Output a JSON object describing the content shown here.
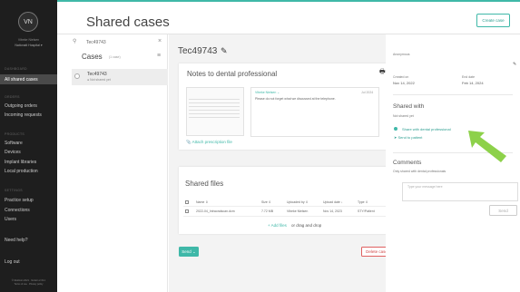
{
  "sidebar": {
    "avatar_initials": "VN",
    "user_name": "Vibeke Nielsen",
    "user_org": "Nationalt Hospital",
    "sections": [
      "DASHBOARD",
      "ORDERS",
      "PRODUCTS",
      "SETTINGS"
    ],
    "items": {
      "all_shared": "All shared cases",
      "outgoing": "Outgoing orders",
      "incoming": "Incoming requests",
      "software": "Software",
      "devices": "Devices",
      "implant": "Implant libraries",
      "local": "Local production",
      "practice": "Practice setup",
      "connections": "Connections",
      "users": "Users",
      "help": "Need help?",
      "logout": "Log out"
    },
    "copyright": "© Medicom 2021 · Version 2.19.1",
    "legal": "Terms of use · Privacy policy"
  },
  "header": {
    "title": "Shared cases",
    "create_button": "Create case"
  },
  "case_list": {
    "search_value": "Tec49743",
    "title": "Cases",
    "count": "(1 case)",
    "items": [
      {
        "id": "Tec49743",
        "status": "Not shared yet"
      }
    ]
  },
  "case": {
    "title": "Tec49743",
    "notes_title": "Notes to dental professional",
    "attach_link": "Attach prescription file",
    "note": {
      "author": "Vibeke Nielsen",
      "date": "Jul 2024",
      "body": "Please do not forget what we discussed at the telephone."
    },
    "files_title": "Shared files",
    "columns": [
      "Name",
      "Size",
      "Uploaded by",
      "Upload date",
      "Type"
    ],
    "files": [
      {
        "name": "2022-04_Intraoralscan.dcm",
        "size": "7.72 MB",
        "by": "Vibeke Nielsen",
        "date": "Nov 14, 2023",
        "type": "STY/Patient"
      }
    ],
    "add_files": "+ Add files",
    "drag_drop": "or drag and drop",
    "send_button": "Send",
    "delete_button": "Delete case"
  },
  "details": {
    "patient": "Anonymous",
    "created_label": "Created on",
    "created_value": "Nov 14, 2022",
    "end_label": "End date",
    "end_value": "Feb 14, 2024",
    "shared_title": "Shared with",
    "shared_status": "Not shared yet",
    "share_professional": "Share with dental professional",
    "send_patient": "Send to patient",
    "comments_title": "Comments",
    "comments_sub": "Only shared with dental professionals",
    "comment_placeholder": "Type your message here",
    "send_comment": "Send"
  },
  "colors": {
    "accent": "#3fb8a8",
    "danger": "#d04848",
    "sidebar_bg": "#1e1e1e",
    "arrow": "#8dd14a"
  }
}
